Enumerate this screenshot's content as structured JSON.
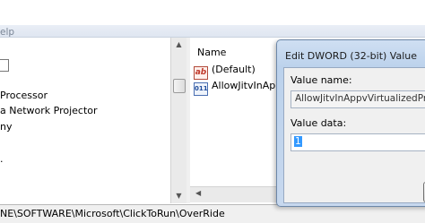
{
  "menubar": {
    "help_fragment": "elp"
  },
  "tree": {
    "items": [
      {
        "label": "e"
      },
      {
        "label": "Processor"
      },
      {
        "label": "a Network Projector"
      },
      {
        "label": "ny"
      },
      {
        "label": "."
      }
    ]
  },
  "list": {
    "columns": [
      "Name"
    ],
    "rows": [
      {
        "icon": "string-value-icon",
        "name": "(Default)"
      },
      {
        "icon": "binary-value-icon",
        "name": "AllowJitvInApp"
      }
    ]
  },
  "statusbar": {
    "path": "NE\\SOFTWARE\\Microsoft\\ClickToRun\\OverRide"
  },
  "dialog": {
    "title": "Edit DWORD (32-bit) Value",
    "value_name_label": "Value name:",
    "value_name": "AllowJitvInAppvVirtualizedProces",
    "value_data_label": "Value data:",
    "value_data": "1"
  },
  "colors": {
    "selection": "#3399ff",
    "dialog_frame": "#bcd2ec"
  }
}
